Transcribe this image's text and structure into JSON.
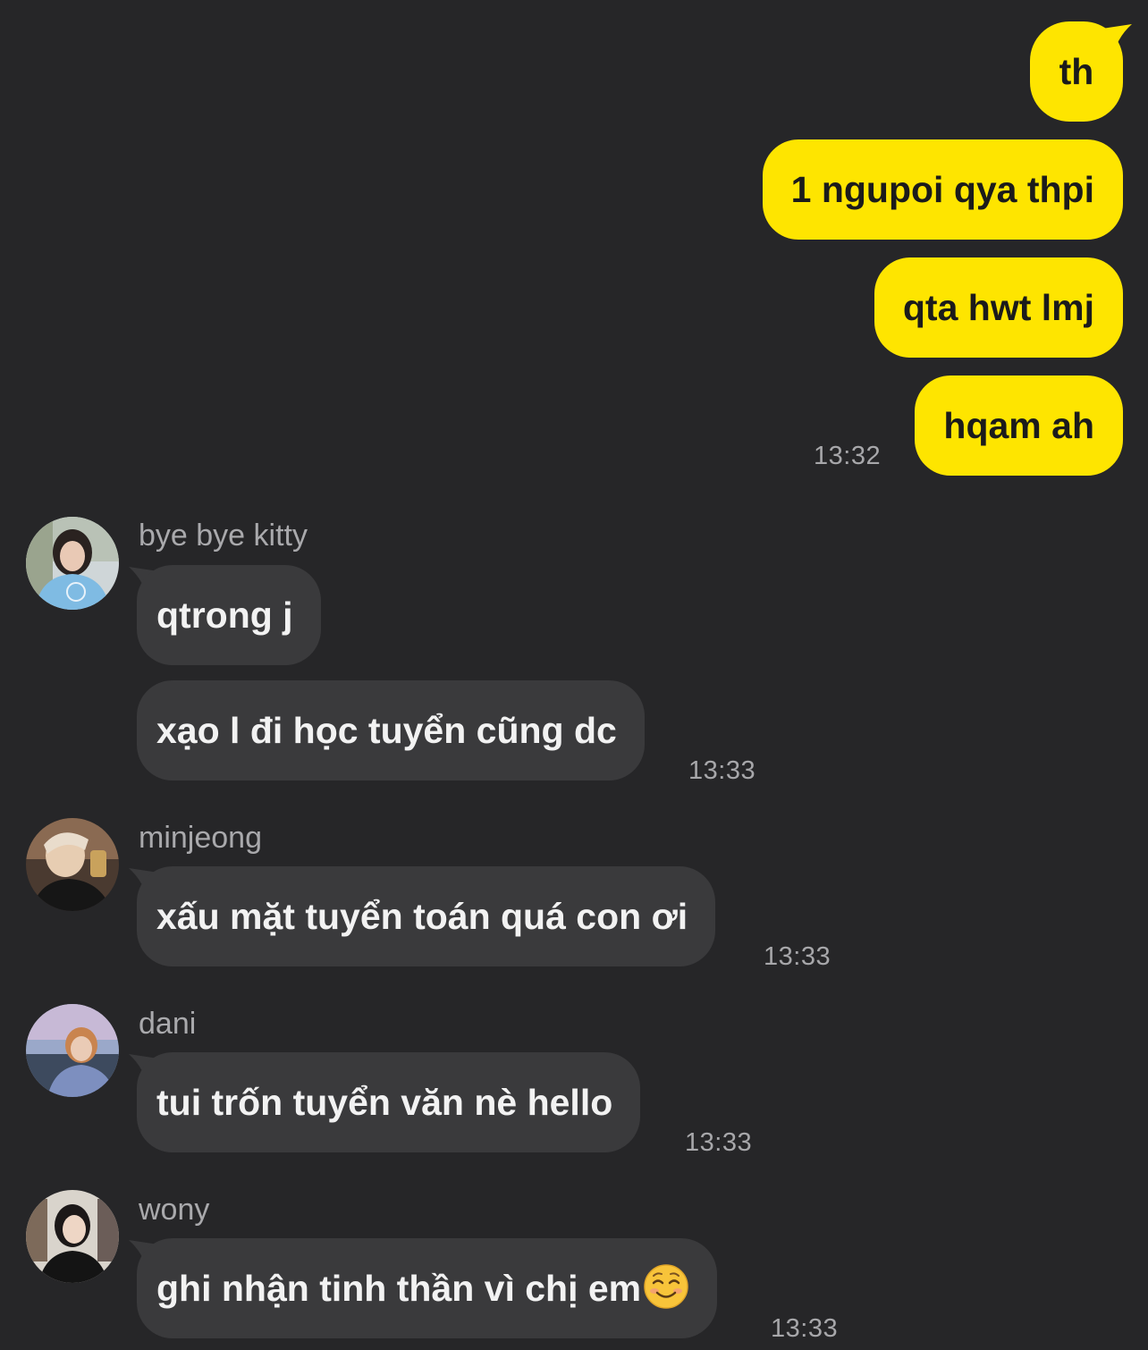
{
  "outgoing": {
    "messages": [
      "th",
      "1 ngupoi qya thpi",
      "qta hwt lmj",
      "hqam ah"
    ],
    "time": "13:32"
  },
  "incoming": [
    {
      "sender": "bye bye kitty",
      "messages": [
        "qtrong j",
        "xạo l đi học tuyển cũng dc"
      ],
      "time": "13:33"
    },
    {
      "sender": "minjeong",
      "messages": [
        "xấu mặt tuyển toán quá con ơi"
      ],
      "time": "13:33"
    },
    {
      "sender": "dani",
      "messages": [
        "tui trốn tuyển văn nè hello"
      ],
      "time": "13:33"
    },
    {
      "sender": "wony",
      "messages": [
        "ghi nhận tinh thần vì chị em"
      ],
      "emoji": "smiling-face-icon",
      "time": "13:33"
    }
  ],
  "colors": {
    "background": "#262628",
    "outgoing_bubble": "#FEE500",
    "incoming_bubble": "#3A3A3C"
  }
}
